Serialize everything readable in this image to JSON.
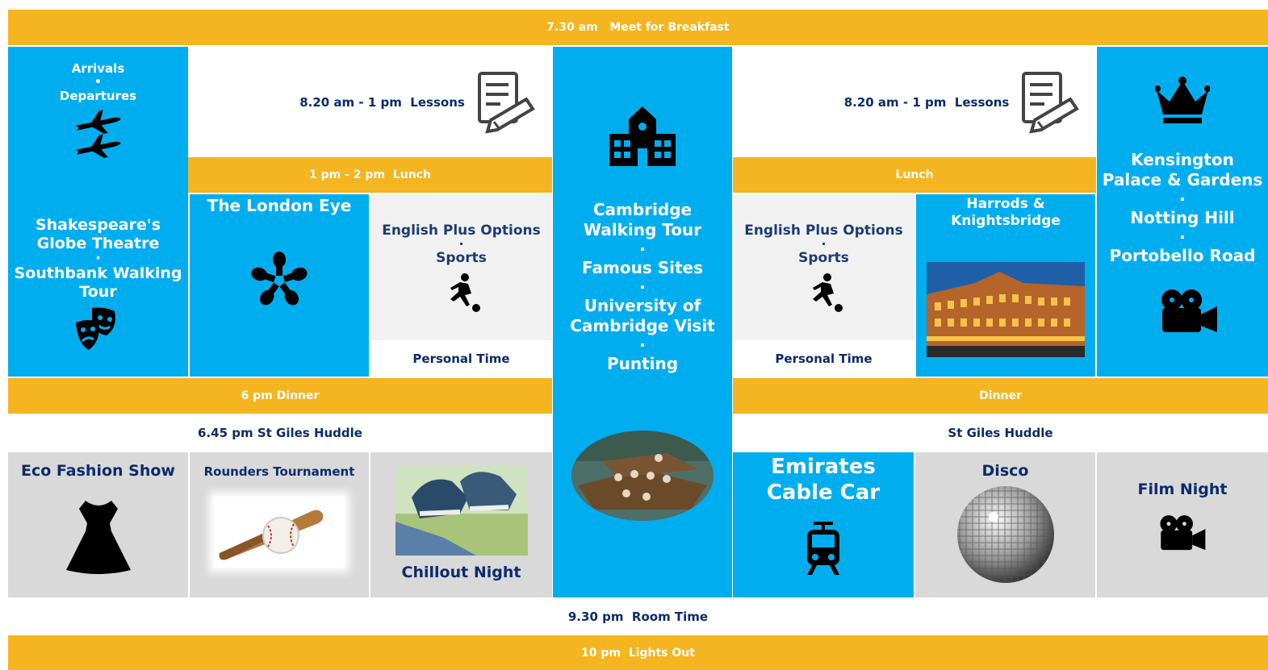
{
  "rows": {
    "breakfast": "7.30 am   Meet for Breakfast",
    "room_time": "9.30 pm  Room Time",
    "lights_out": "10 pm  Lights Out"
  },
  "col1": {
    "arrivals": "Arrivals",
    "sep": "•",
    "departures": "Departures",
    "globe": "Shakespeare's Globe Theatre",
    "dot": "·",
    "southbank": "Southbank Walking Tour",
    "eco": "Eco Fashion Show"
  },
  "col2": {
    "lessons": "8.20 am - 1 pm  Lessons",
    "lunch": "1 pm - 2 pm  Lunch",
    "london_eye": "The London Eye",
    "english_plus": "English Plus Options",
    "dot": "·",
    "sports": "Sports",
    "personal_time": "Personal Time",
    "dinner": "6 pm Dinner",
    "huddle": "6.45 pm St Giles Huddle",
    "rounders": "Rounders Tournament",
    "chillout": "Chillout Night"
  },
  "col3": {
    "cambridge_tour": "Cambridge Walking Tour",
    "dot": "·",
    "famous_sites": "Famous Sites",
    "university": "University of Cambridge Visit",
    "punting": "Punting"
  },
  "col4": {
    "lessons": "8.20 am - 1 pm  Lessons",
    "lunch": "Lunch",
    "english_plus": "English Plus Options",
    "dot": "·",
    "sports": "Sports",
    "personal_time": "Personal Time",
    "harrods": "Harrods & Knightsbridge",
    "dinner": "Dinner",
    "huddle": "St Giles Huddle",
    "cable_car": "Emirates Cable Car",
    "disco": "Disco"
  },
  "col5": {
    "kensington": "Kensington Palace & Gardens",
    "dot": "·",
    "notting_hill": "Notting Hill",
    "portobello": "Portobello Road",
    "film_night": "Film Night"
  },
  "icons": {
    "lessons": "document-pencil-icon",
    "planes": "airplane-icon",
    "theatre": "theatre-masks-icon",
    "hands": "teamwork-hands-icon",
    "sports": "football-player-icon",
    "school": "school-building-icon",
    "crown": "crown-icon",
    "camera": "movie-camera-icon",
    "dress": "dress-icon",
    "train": "tram-icon"
  },
  "colors": {
    "orange": "#f5b520",
    "blue": "#00aeef",
    "navy": "#0d2a6a",
    "grey": "#d9d9d9"
  }
}
